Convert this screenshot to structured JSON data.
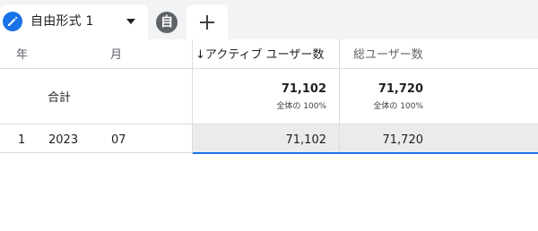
{
  "tabs": {
    "active_label": "自由形式 1",
    "chip_label": "自",
    "icons": {
      "edit": "pencil-icon",
      "menu": "caret-down-icon",
      "add": "plus-icon"
    }
  },
  "table": {
    "headers": {
      "col1": "年",
      "col2": "月",
      "col3": "↓アクティブ ユーザー数",
      "col4": "総ユーザー数"
    },
    "totals": {
      "label": "合計",
      "active_users": "71,102",
      "active_users_pct": "全体の 100%",
      "total_users": "71,720",
      "total_users_pct": "全体の 100%"
    },
    "rows": [
      {
        "index": "1",
        "year": "2023",
        "month": "07",
        "active_users": "71,102",
        "total_users": "71,720"
      }
    ]
  },
  "colors": {
    "accent": "#1a73e8",
    "tab_bar": "#f1f3f4",
    "row_highlight": "#ebebeb",
    "chip": "#5f6368"
  }
}
